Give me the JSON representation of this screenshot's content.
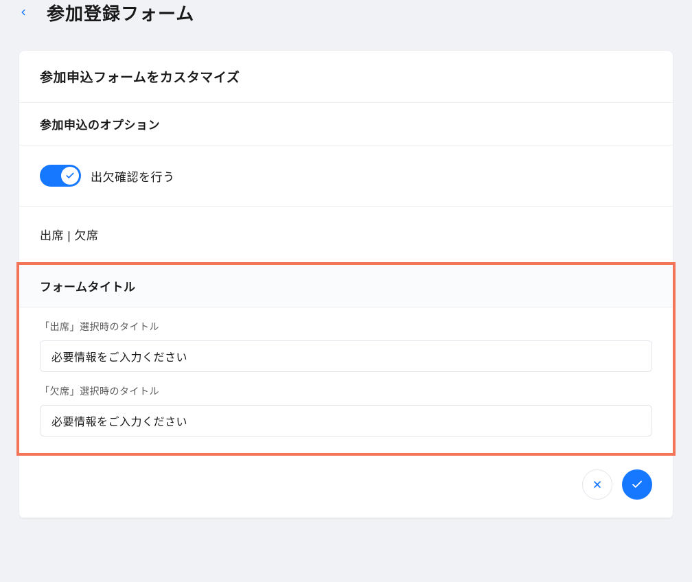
{
  "header": {
    "title": "参加登録フォーム"
  },
  "card": {
    "main_heading": "参加申込フォームをカスタマイズ",
    "options_heading": "参加申込のオプション",
    "attendance_toggle": {
      "label": "出欠確認を行う",
      "on": true
    },
    "attendance_value": "出席 | 欠席",
    "form_title_section": {
      "heading": "フォームタイトル",
      "fields": [
        {
          "label": "「出席」選択時のタイトル",
          "value": "必要情報をご入力ください"
        },
        {
          "label": "「欠席」選択時のタイトル",
          "value": "必要情報をご入力ください"
        }
      ]
    }
  },
  "colors": {
    "accent": "#1677ff",
    "highlight_border": "#f47458"
  }
}
